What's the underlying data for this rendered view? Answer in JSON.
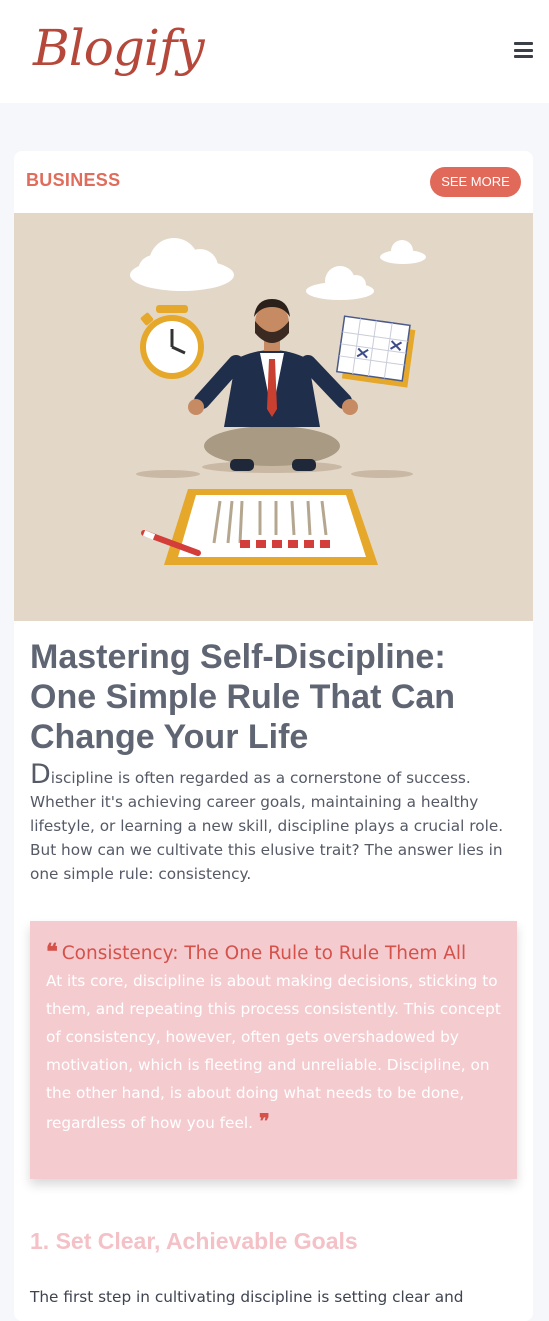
{
  "header": {
    "logo_text": "Blogify",
    "menu_icon": "hamburger-menu-icon"
  },
  "post": {
    "category": "BUSINESS",
    "see_more_label": "SEE MORE",
    "image_alt": "Illustration of a businessman meditating cross-legged between a clock and a calendar, above a checklist",
    "title": "Mastering Self-Discipline: One Simple Rule That Can Change Your Life",
    "intro_first_letter": "D",
    "intro_rest": "iscipline is often regarded as a cornerstone of success. Whether it's achieving career goals, maintaining a healthy lifestyle, or learning a new skill, discipline plays a crucial role. But how can we cultivate this elusive trait? The answer lies in one simple rule: consistency.",
    "quote": {
      "title": "Consistency: The One Rule to Rule Them All",
      "body": "At its core, discipline is about making decisions, sticking to them, and repeating this process consistently. This concept of consistency, however, often gets overshadowed by motivation, which is fleeting and unreliable. Discipline, on the other hand, is about doing what needs to be done, regardless of how you feel.",
      "open_mark": "❝",
      "close_mark": "❞"
    },
    "section_heading": "1. Set Clear, Achievable Goals",
    "section_text": "The first step in cultivating discipline is setting clear and"
  },
  "colors": {
    "brand": "#b5483a",
    "accent": "#e0695a",
    "title": "#5f6573",
    "quote_bg": "#f4ccd0",
    "hero_bg": "#e3d7c8"
  }
}
